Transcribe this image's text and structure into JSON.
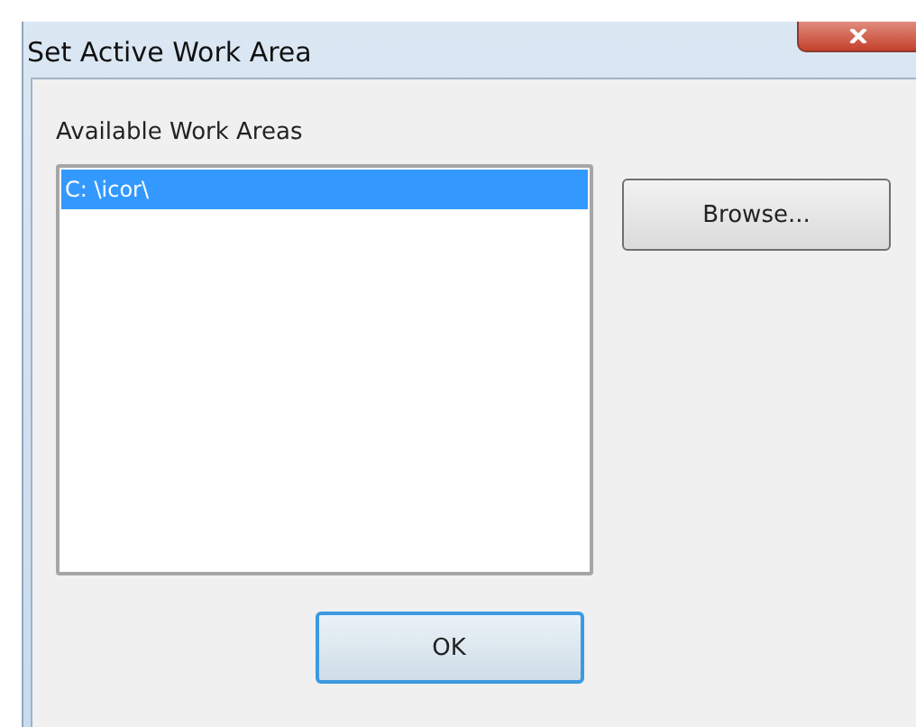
{
  "window": {
    "title": "Set Active Work Area"
  },
  "work_areas": {
    "label": "Available Work Areas",
    "items": [
      {
        "path": "C: \\icor\\",
        "selected": true
      }
    ]
  },
  "buttons": [
    {
      "label": "Browse...",
      "kind": "side"
    },
    {
      "label": "OK",
      "kind": "default"
    }
  ]
}
